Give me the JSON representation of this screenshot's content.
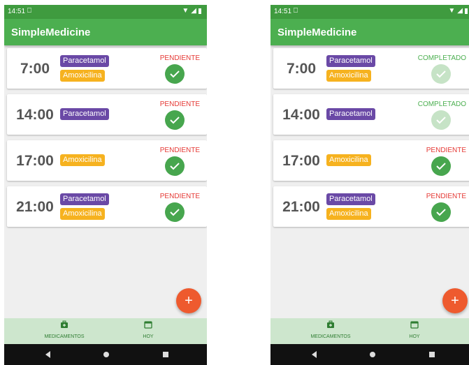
{
  "app": {
    "title": "SimpleMedicine"
  },
  "statusbar": {
    "time": "14:51",
    "sim_icon": "sim-icon"
  },
  "screens": [
    {
      "rows": [
        {
          "time": "7:00",
          "chips": [
            "Paracetamol",
            "Amoxicilina"
          ],
          "status": "PENDIENTE"
        },
        {
          "time": "14:00",
          "chips": [
            "Paracetamol"
          ],
          "status": "PENDIENTE"
        },
        {
          "time": "17:00",
          "chips": [
            "Amoxicilina"
          ],
          "status": "PENDIENTE"
        },
        {
          "time": "21:00",
          "chips": [
            "Paracetamol",
            "Amoxicilina"
          ],
          "status": "PENDIENTE"
        }
      ]
    },
    {
      "rows": [
        {
          "time": "7:00",
          "chips": [
            "Paracetamol",
            "Amoxicilina"
          ],
          "status": "COMPLETADO"
        },
        {
          "time": "14:00",
          "chips": [
            "Paracetamol"
          ],
          "status": "COMPLETADO"
        },
        {
          "time": "17:00",
          "chips": [
            "Amoxicilina"
          ],
          "status": "PENDIENTE"
        },
        {
          "time": "21:00",
          "chips": [
            "Paracetamol",
            "Amoxicilina"
          ],
          "status": "PENDIENTE"
        }
      ]
    }
  ],
  "fab": {
    "label": "+"
  },
  "bottomnav": {
    "medicamentos": "MEDICAMENTOS",
    "hoy": "HOY"
  },
  "colors": {
    "primary": "#4caf50",
    "primary_dark": "#3f9b3f",
    "paracetamol": "#6a49a6",
    "amoxicilina": "#f6b21f",
    "pending": "#e53935",
    "completed": "#4caf50",
    "fab": "#ee5a2e"
  }
}
